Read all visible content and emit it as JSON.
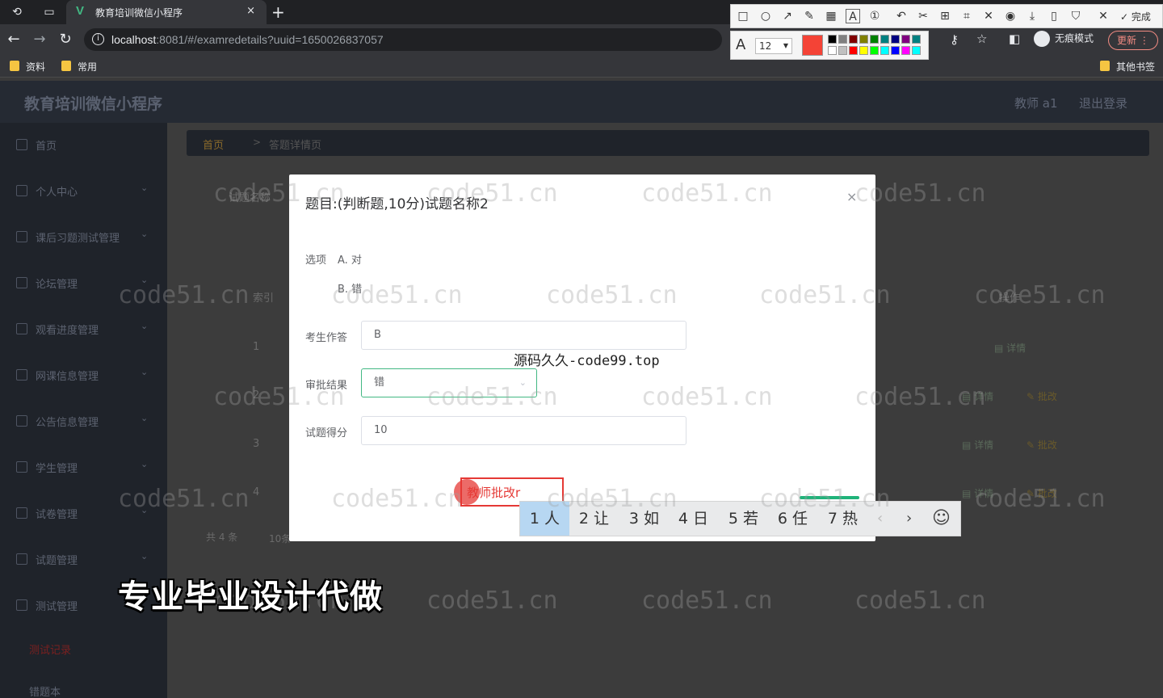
{
  "browser": {
    "tab_title": "教育培训微信小程序",
    "tab_close": "×",
    "new_tab": "+",
    "url_host": "localhost",
    "url_path": ":8081/#/examredetails?uuid=1650026837057",
    "bookmarks": [
      "资料",
      "常用"
    ],
    "other_bookmarks": "其他书签",
    "incognito_label": "无痕模式",
    "update_label": "更新"
  },
  "screenshot_tool": {
    "done_label": "完成",
    "font_size": "12",
    "current_color": "#f44336",
    "palette": [
      "#000000",
      "#808080",
      "#800000",
      "#808000",
      "#008000",
      "#008080",
      "#000080",
      "#800080",
      "#008080",
      "#ffffff",
      "#c0c0c0",
      "#ff0000",
      "#ffff00",
      "#00ff00",
      "#00ffff",
      "#0000ff",
      "#ff00ff",
      "#00ffff"
    ]
  },
  "app": {
    "title": "教育培训微信小程序",
    "user": "教师 a1",
    "logout": "退出登录"
  },
  "sidebar": {
    "items": [
      {
        "label": "首页",
        "icon": "home-icon"
      },
      {
        "label": "个人中心",
        "icon": "user-icon"
      },
      {
        "label": "课后习题测试管理",
        "icon": "clock-icon"
      },
      {
        "label": "论坛管理",
        "icon": "refresh-icon"
      },
      {
        "label": "观看进度管理",
        "icon": "person-icon"
      },
      {
        "label": "网课信息管理",
        "icon": "frame-icon"
      },
      {
        "label": "公告信息管理",
        "icon": "lock-icon"
      },
      {
        "label": "学生管理",
        "icon": "mail-icon"
      },
      {
        "label": "试卷管理",
        "icon": "bar-chart-icon"
      },
      {
        "label": "试题管理",
        "icon": "copy-icon"
      },
      {
        "label": "测试管理",
        "icon": "gear-icon"
      }
    ],
    "sub_active": "测试记录",
    "sub_next": "错题本"
  },
  "breadcrumb": {
    "home": "首页",
    "current": "答题详情页"
  },
  "background": {
    "filter_label": "试题名称",
    "col_index": "索引",
    "col_action": "操作",
    "rows": [
      "1",
      "2",
      "3",
      "4"
    ],
    "detail": "详情",
    "approve": "批改",
    "total": "共 4 条",
    "per_page": "10条"
  },
  "modal": {
    "title": "题目:(判断题,10分)试题名称2",
    "options_label": "选项",
    "option_a": "A. 对",
    "option_b": "B. 错",
    "answer_label": "考生作答",
    "answer_value": "B",
    "result_label": "审批结果",
    "result_value": "错",
    "score_label": "试题得分",
    "score_value": "10"
  },
  "annotation": {
    "text": "教师批改r"
  },
  "ime": {
    "candidates": [
      "1 人",
      "2 让",
      "3 如",
      "4 日",
      "5 若",
      "6 任",
      "7 热"
    ],
    "prev": "‹",
    "next": "›",
    "emoji": "☺"
  },
  "overlays": {
    "watermark": "code51.cn",
    "center_mark": "源码久久-code99.top",
    "promo": "专业毕业设计代做"
  }
}
